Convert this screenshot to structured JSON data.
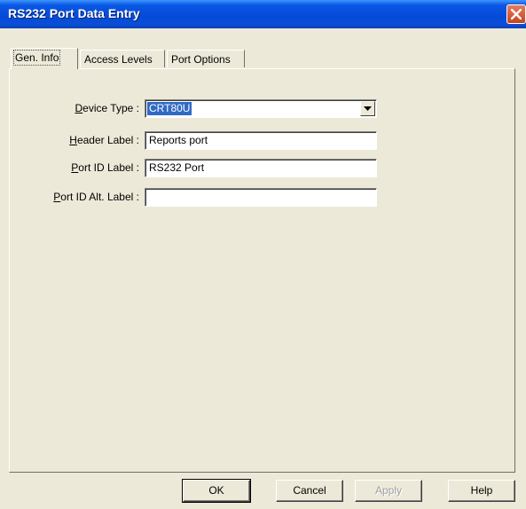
{
  "window": {
    "title": "RS232 Port Data Entry"
  },
  "tabs": [
    {
      "label": "Gen. Info",
      "active": true
    },
    {
      "label": "Access Levels",
      "active": false
    },
    {
      "label": "Port Options",
      "active": false
    }
  ],
  "form": {
    "device_type": {
      "label": "Device Type :",
      "label_underline": "D",
      "label_rest": "evice Type :",
      "value": "CRT80U"
    },
    "header_label": {
      "label": "Header Label :",
      "label_underline": "H",
      "label_rest": "eader Label :",
      "value": "Reports port"
    },
    "port_id_label": {
      "label": "Port ID Label :",
      "label_underline": "P",
      "label_rest": "ort ID Label :",
      "value": "RS232 Port"
    },
    "port_id_alt_label": {
      "label": "Port ID Alt. Label :",
      "label_underline": "P",
      "label_rest": "ort ID Alt. Label :",
      "value": ""
    }
  },
  "buttons": {
    "ok": {
      "label": "OK",
      "enabled": true
    },
    "cancel": {
      "label": "Cancel",
      "enabled": true
    },
    "apply": {
      "label": "Apply",
      "enabled": false
    },
    "help": {
      "label": "Help",
      "enabled": true
    }
  },
  "colors": {
    "titlebar": "#0549d8",
    "dialog_bg": "#ece9d8",
    "selection": "#316ac5",
    "close_button": "#d55a32"
  },
  "icons": {
    "close": "close-x-icon",
    "dropdown": "chevron-down-icon"
  }
}
